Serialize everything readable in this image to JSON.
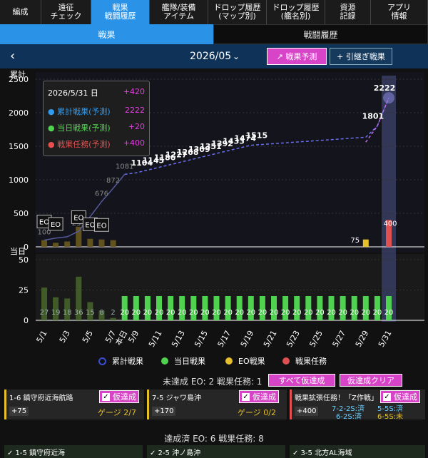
{
  "nav": {
    "items": [
      {
        "label": "編成",
        "active": false
      },
      {
        "label": "遠征\nチェック",
        "active": false
      },
      {
        "label": "戦果\n戦闘履歴",
        "active": true
      },
      {
        "label": "艦隊/装備\nアイテム",
        "active": false
      },
      {
        "label": "ドロップ履歴\n(マップ別)",
        "active": false
      },
      {
        "label": "ドロップ履歴\n(艦名別)",
        "active": false
      },
      {
        "label": "資源\n記録",
        "active": false
      },
      {
        "label": "アプリ\n情報",
        "active": false
      }
    ]
  },
  "subtabs": [
    {
      "label": "戦果",
      "active": true
    },
    {
      "label": "戦闘履歴",
      "active": false
    }
  ],
  "toolbar": {
    "back_icon": "‹",
    "month": "2026/05",
    "caret_icon": "⌄",
    "forecast_label": "↗ 戦果予測",
    "carryover_label": "+ 引継ぎ戦果"
  },
  "tooltip": {
    "date": "2026/5/31 日",
    "date_value": "+420",
    "rows": [
      {
        "label": "● 累計戦果(予測)",
        "value": "2222",
        "color": "#2f9bf0"
      },
      {
        "label": "● 当日戦果(予測)",
        "value": "+20",
        "color": "#4fd24f"
      },
      {
        "label": "● 戦果任務(予測)",
        "value": "+400",
        "color": "#e85050"
      }
    ]
  },
  "chart_data": {
    "type": "bar",
    "top_axis_label": "累計",
    "bottom_axis_label": "当日",
    "top_ylim": [
      0,
      2500
    ],
    "top_yticks": [
      0,
      500,
      1000,
      1500,
      2000,
      2500
    ],
    "bottom_ylim": [
      0,
      50
    ],
    "bottom_yticks": [
      0,
      25,
      50
    ],
    "x_ticks": [
      "5/1",
      "5/3",
      "5/5",
      "5/7",
      "本日",
      "5/9",
      "5/11",
      "5/13",
      "5/15",
      "5/17",
      "5/19",
      "5/21",
      "5/23",
      "5/25",
      "5/27",
      "5/29",
      "5/31"
    ],
    "days": [
      1,
      2,
      3,
      4,
      5,
      6,
      7,
      8,
      9,
      10,
      11,
      12,
      13,
      14,
      15,
      16,
      17,
      18,
      19,
      20,
      21,
      22,
      23,
      24,
      25,
      26,
      27,
      28,
      29,
      30,
      31
    ],
    "cumulative_actual_labels": [
      "100",
      "",
      "",
      "233",
      "",
      "676",
      "872",
      "1081"
    ],
    "cumulative": [
      100,
      130,
      150,
      233,
      450,
      676,
      872,
      1081,
      1104,
      1145,
      1186,
      1227,
      1268,
      1309,
      1351,
      1392,
      1433,
      1474,
      1515,
      null,
      null,
      null,
      null,
      null,
      null,
      null,
      null,
      null,
      null,
      1801,
      2222
    ],
    "cumulative_forecast_labels": [
      "1104",
      "1145",
      "1186",
      "1227",
      "1268",
      "1309",
      "1351",
      "1392",
      "1433",
      "1474",
      "1515",
      "1801",
      "2222"
    ],
    "daily": [
      27,
      19,
      18,
      36,
      15,
      8,
      2,
      20,
      20,
      20,
      20,
      20,
      20,
      20,
      20,
      20,
      20,
      20,
      20,
      20,
      20,
      20,
      20,
      20,
      20,
      20,
      20,
      20,
      20,
      20,
      20
    ],
    "daily_labels": [
      "27",
      "19",
      "18",
      "36",
      "15",
      "8",
      "2",
      "20"
    ],
    "eo_markers": [
      "EO",
      "EO",
      "EO",
      "EO",
      "EO"
    ],
    "eo_days": [
      1,
      2,
      4,
      5,
      6
    ],
    "task_value_day29": "75",
    "task_value_day31": "400",
    "series": [
      {
        "name": "累計戦果",
        "color": "#3b4bd8"
      },
      {
        "name": "当日戦果",
        "color": "#4fd24f"
      },
      {
        "name": "EO戦果",
        "color": "#e6c02a"
      },
      {
        "name": "戦果任務",
        "color": "#e05050"
      }
    ]
  },
  "status": {
    "text": "未達成 EO: 2 戦果任務: 1",
    "all_btn": "すべて仮達成",
    "clear_btn": "仮達成クリア"
  },
  "cards": [
    {
      "title": "1-6 鎮守府近海航路",
      "check": "仮達成",
      "amount": "+75",
      "gauge": "ゲージ 2/7"
    },
    {
      "title": "7-5 ジャワ島沖",
      "check": "仮達成",
      "amount": "+170",
      "gauge": "ゲージ 0/2"
    },
    {
      "title": "戦果拡張任務！「Z作戦」",
      "check": "仮達成",
      "amount": "+400",
      "reqs": [
        "7-2-2S:済",
        "5-5S:済",
        "6-2S:済",
        "6-5S:未"
      ]
    }
  ],
  "done": {
    "title": "達成済 EO: 6 戦果任務: 8",
    "items": [
      "✓ 1-5 鎮守府近海",
      "✓ 2-5 沖ノ島沖",
      "✓ 3-5 北方AL海域"
    ]
  }
}
